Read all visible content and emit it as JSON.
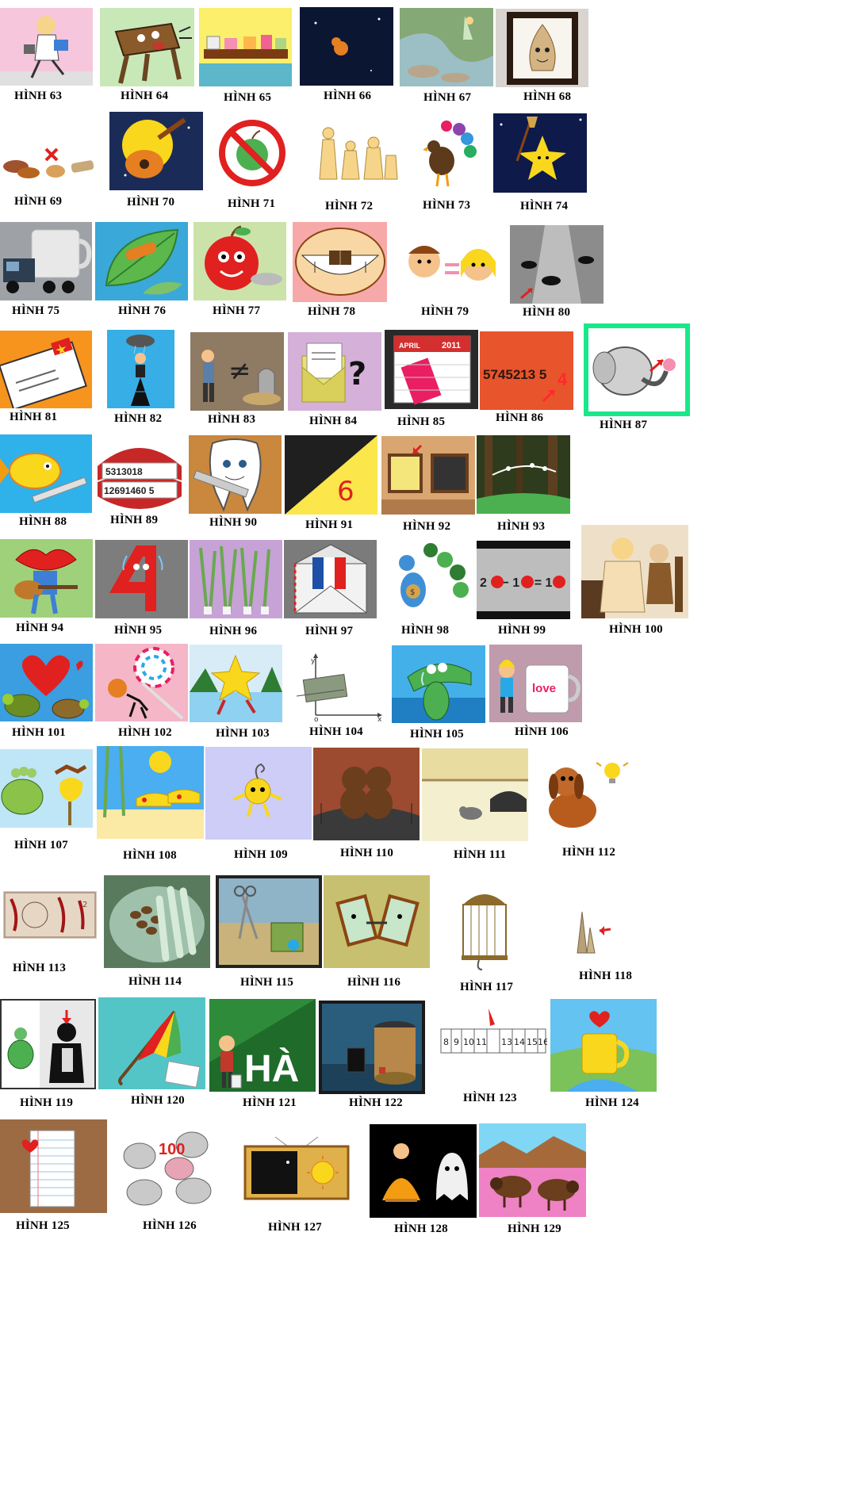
{
  "labels": {
    "h63": "HÌNH 63",
    "h64": "HÌNH 64",
    "h65": "HÌNH 65",
    "h66": "HÌNH 66",
    "h67": "HÌNH 67",
    "h68": "HÌNH 68",
    "h69": "HÌNH 69",
    "h70": "HÌNH 70",
    "h71": "HÌNH 71",
    "h72": "HÌNH 72",
    "h73": "HÌNH 73",
    "h74": "HÌNH 74",
    "h75": "HÌNH 75",
    "h76": "HÌNH 76",
    "h77": "HÌNH 77",
    "h78": "HÌNH 78",
    "h79": "HÌNH 79",
    "h80": "HÌNH 80",
    "h81": "HÌNH 81",
    "h82": "HÌNH 82",
    "h83": "HÌNH 83",
    "h84": "HÌNH 84",
    "h85": "HÌNH 85",
    "h86": "HÌNH 86",
    "h87": "HÌNH 87",
    "h88": "HÌNH 88",
    "h89": "HÌNH 89",
    "h90": "HÌNH 90",
    "h91": "HÌNH 91",
    "h92": "HÌNH 92",
    "h93": "HÌNH 93",
    "h94": "HÌNH 94",
    "h95": "HÌNH 95",
    "h96": "HÌNH 96",
    "h97": "HÌNH 97",
    "h98": "HÌNH 98",
    "h99": "HÌNH 99",
    "h100": "HÌNH 100",
    "h101": "HÌNH 101",
    "h102": "HÌNH 102",
    "h103": "HÌNH 103",
    "h104": "HÌNH 104",
    "h105": "HÌNH 105",
    "h106": "HÌNH 106",
    "h107": "HÌNH 107",
    "h108": "HÌNH 108",
    "h109": "HÌNH 109",
    "h110": "HÌNH 110",
    "h111": "HÌNH 111",
    "h112": "HÌNH 112",
    "h113": "HÌNH 113",
    "h114": "HÌNH 114",
    "h115": "HÌNH 115",
    "h116": "HÌNH 116",
    "h117": "HÌNH 117",
    "h118": "HÌNH 118",
    "h119": "HÌNH 119",
    "h120": "HÌNH 120",
    "h121": "HÌNH 121",
    "h122": "HÌNH 122",
    "h123": "HÌNH 123",
    "h124": "HÌNH 124",
    "h125": "HÌNH 125",
    "h126": "HÌNH 126",
    "h127": "HÌNH 127",
    "h128": "HÌNH 128",
    "h129": "HÌNH 129"
  },
  "picture_text": {
    "p85_month": "APRIL",
    "p85_year": "2011",
    "p86_digits": "5745213 5",
    "p86_red_digit": "4",
    "p89_row1": "5313018",
    "p89_row2": "12691460 5",
    "p91_digit": "6",
    "p99_expr": "2 ● − 1 ● = 1 ●",
    "p104_y": "y",
    "p104_x": "x",
    "p104_o": "o",
    "p106_mug": "love",
    "p121_word": "HÀ",
    "p123_ruler": [
      "8",
      "9",
      "10",
      "11",
      "13",
      "14",
      "15",
      "16"
    ],
    "p126_num": "100"
  },
  "colors": {
    "sky_blue": "#29a8e6",
    "orange": "#f7941d",
    "pink": "#f2b6c6",
    "green_bright": "#19e88a",
    "night": "#0b1633",
    "red": "#e0211f"
  }
}
